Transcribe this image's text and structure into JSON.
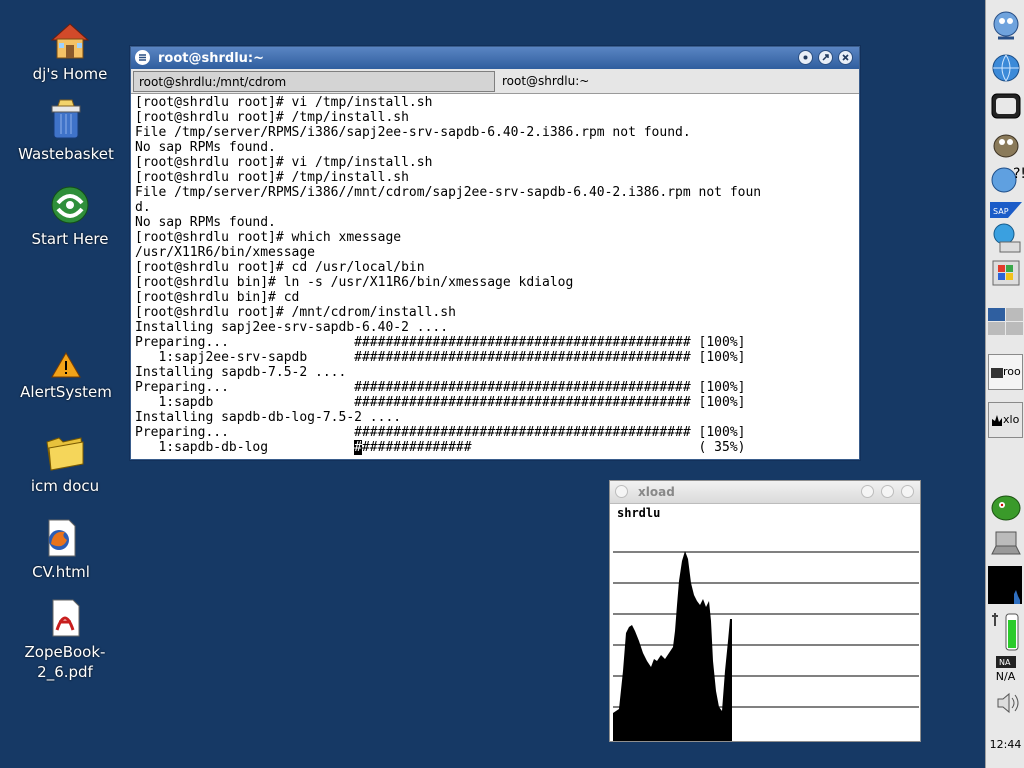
{
  "desktop": {
    "icons": [
      {
        "label": "dj's Home",
        "icon": "home-icon"
      },
      {
        "label": "Wastebasket",
        "icon": "trash-icon"
      },
      {
        "label": "Start Here",
        "icon": "start-here-icon"
      },
      {
        "label": "AlertSystem",
        "icon": "warning-icon"
      },
      {
        "label": "icm docu",
        "icon": "folder-icon"
      },
      {
        "label": "CV.html",
        "icon": "firefox-html-icon"
      },
      {
        "label": "ZopeBook-\n2_6.pdf",
        "icon": "pdf-icon"
      }
    ]
  },
  "terminal": {
    "title": "root@shrdlu:~",
    "tabs": [
      "root@shrdlu:/mnt/cdrom",
      "root@shrdlu:~"
    ],
    "lines": [
      "[root@shrdlu root]# vi /tmp/install.sh",
      "[root@shrdlu root]# /tmp/install.sh",
      "File /tmp/server/RPMS/i386/sapj2ee-srv-sapdb-6.40-2.i386.rpm not found.",
      "No sap RPMs found.",
      "[root@shrdlu root]# vi /tmp/install.sh",
      "[root@shrdlu root]# /tmp/install.sh",
      "File /tmp/server/RPMS/i386//mnt/cdrom/sapj2ee-srv-sapdb-6.40-2.i386.rpm not foun",
      "d.",
      "No sap RPMs found.",
      "[root@shrdlu root]# which xmessage",
      "/usr/X11R6/bin/xmessage",
      "[root@shrdlu root]# cd /usr/local/bin",
      "[root@shrdlu bin]# ln -s /usr/X11R6/bin/xmessage kdialog",
      "[root@shrdlu bin]# cd",
      "[root@shrdlu root]# /mnt/cdrom/install.sh",
      "Installing sapj2ee-srv-sapdb-6.40-2 ....",
      "Preparing...                ########################################### [100%]",
      "   1:sapj2ee-srv-sapdb      ########################################### [100%]",
      "Installing sapdb-7.5-2 ....",
      "Preparing...                ########################################### [100%]",
      "   1:sapdb                  ########################################### [100%]",
      "Installing sapdb-db-log-7.5-2 ....",
      "Preparing...                ########################################### [100%]"
    ],
    "last_line_prefix": "   1:sapdb-db-log           ",
    "last_line_cursor": "#",
    "last_line_rest": "##############                             ( 35%)",
    "progress_percent": 35
  },
  "xload": {
    "title": "xload",
    "host": "shrdlu"
  },
  "panel": {
    "tasks": [
      "roo",
      "xlo"
    ],
    "power_label": "N/A",
    "clock": "12:44"
  }
}
